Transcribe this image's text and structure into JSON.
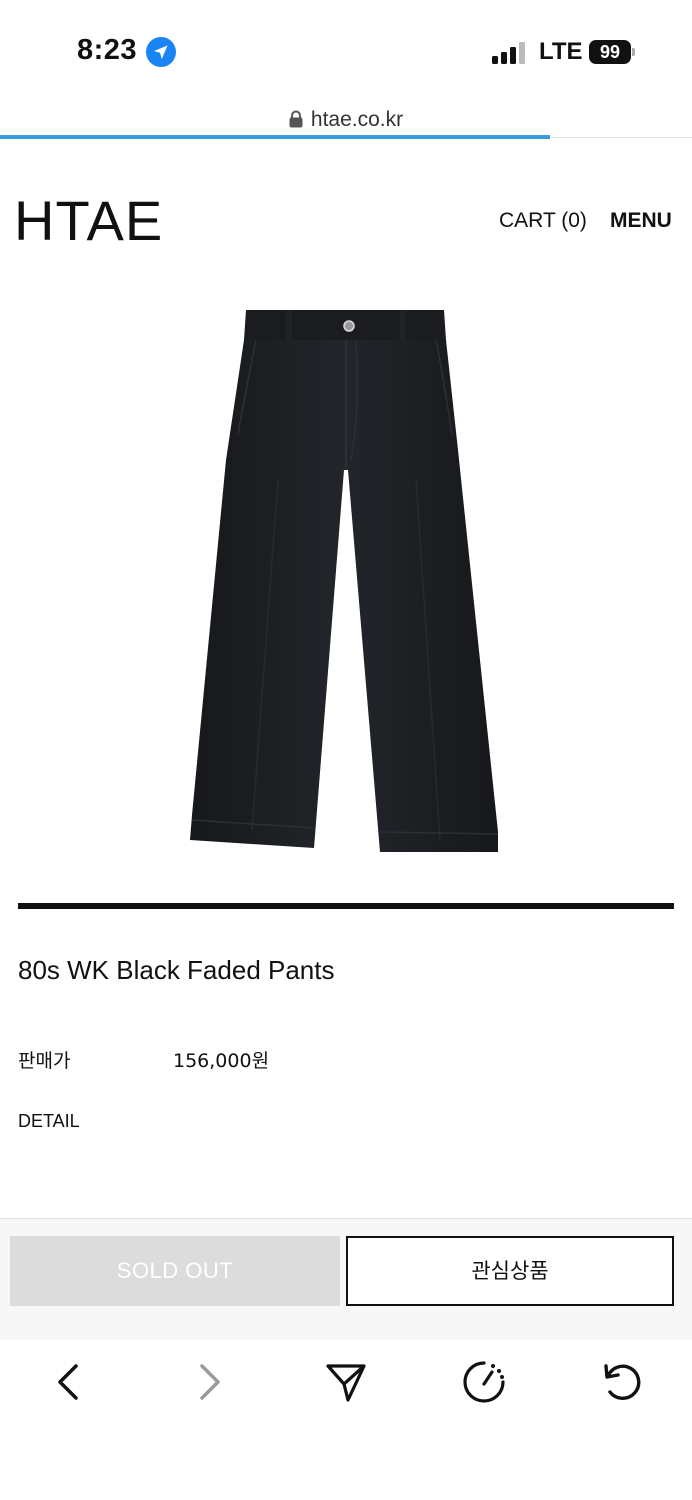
{
  "status_bar": {
    "time": "8:23",
    "network": "LTE",
    "battery": "99"
  },
  "browser": {
    "url": "htae.co.kr",
    "load_progress_percent": 79.5
  },
  "header": {
    "logo": "HTAE",
    "cart": "CART (0)",
    "menu": "MENU"
  },
  "product": {
    "image_alt": "black pants",
    "name": "80s WK Black Faded Pants",
    "price_label": "판매가",
    "price_value": "156,000원",
    "detail_label": "DETAIL"
  },
  "actions": {
    "sold_out": "SOLD OUT",
    "wishlist": "관심상품"
  },
  "toolbar": {
    "icons": [
      "back-icon",
      "forward-icon",
      "share-icon",
      "speed-dial-icon",
      "reload-icon"
    ]
  },
  "colors": {
    "accent": "#3a9bdc",
    "sold_out_bg": "#dcdcdd",
    "product_dark": "#1b1d20"
  }
}
